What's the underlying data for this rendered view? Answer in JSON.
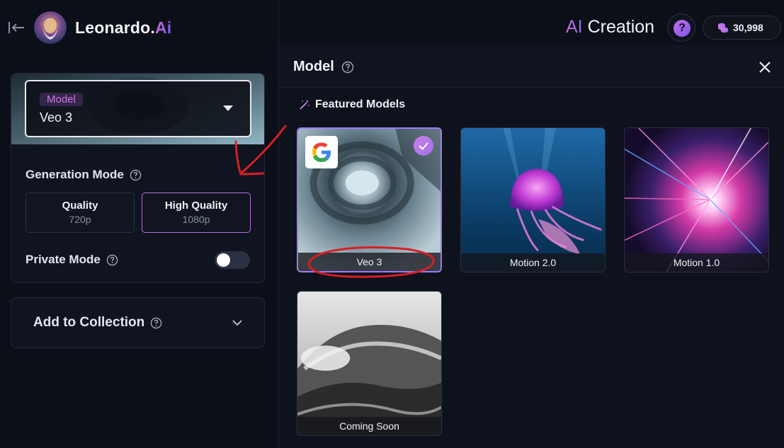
{
  "brand": {
    "name_main": "Leonardo.",
    "name_ai": "Ai"
  },
  "topbar": {
    "title_ai": "AI",
    "title_rest": " Creation",
    "help_label": "?",
    "token_count": "30,998"
  },
  "sidebar": {
    "model": {
      "chip": "Model",
      "value": "Veo 3"
    },
    "generation_mode": {
      "label": "Generation Mode",
      "options": [
        {
          "title": "Quality",
          "sub": "720p",
          "active": false
        },
        {
          "title": "High Quality",
          "sub": "1080p",
          "active": true
        }
      ]
    },
    "private_mode": {
      "label": "Private Mode",
      "enabled": false
    },
    "collection": {
      "label": "Add to Collection"
    }
  },
  "panel": {
    "title": "Model",
    "section_title": "Featured Models",
    "models": [
      {
        "name": "Veo 3",
        "selected": true,
        "provider_icon": "google-icon"
      },
      {
        "name": "Motion 2.0",
        "selected": false
      },
      {
        "name": "Motion 1.0",
        "selected": false
      },
      {
        "name": "Coming Soon",
        "selected": false
      }
    ]
  },
  "colors": {
    "accent": "#b572d8",
    "selected_border": "#9d7cf4",
    "annotation": "#d61f26"
  }
}
